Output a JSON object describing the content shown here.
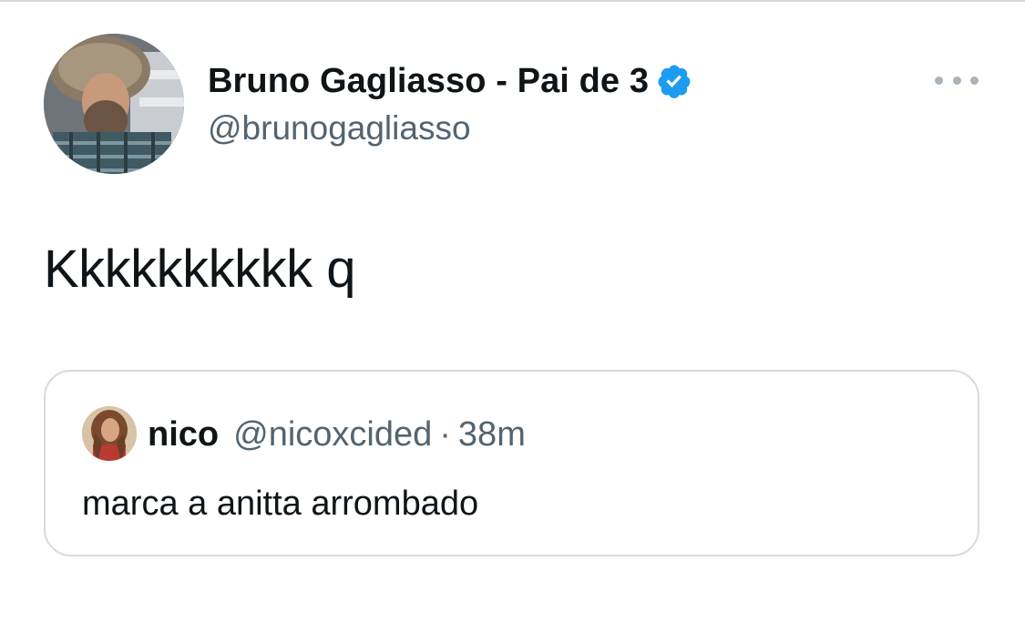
{
  "tweet": {
    "author": {
      "display_name": "Bruno Gagliasso - Pai de 3",
      "handle": "@brunogagliasso",
      "verified": true
    },
    "text": "Kkkkkkkkkk q",
    "more_icon": "more-horizontal-icon"
  },
  "quoted_tweet": {
    "author": {
      "display_name": "nico",
      "handle": "@nicoxcided"
    },
    "separator": "·",
    "time": "38m",
    "text": "marca a anitta arrombado"
  },
  "colors": {
    "text_primary": "#0f1419",
    "text_secondary": "#536471",
    "verified_blue": "#1d9bf0",
    "border": "#d6dbdf"
  }
}
